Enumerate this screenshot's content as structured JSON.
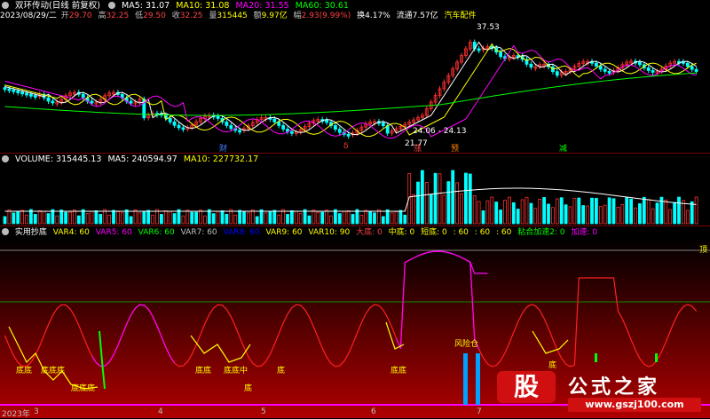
{
  "price_header": {
    "title": "双环传动(日线 前复权)",
    "ma5": "MA5: 31.07",
    "ma10": "MA10: 31.08",
    "ma20": "MA20: 31.55",
    "ma60": "MA60: 30.61",
    "colors": {
      "ma5": "#ffffff",
      "ma10": "#ffff00",
      "ma20": "#ff00ff",
      "ma60": "#00ff00"
    }
  },
  "quote_line": {
    "date": "2023/08/29/二",
    "open_label": "开",
    "open": "29.70",
    "high_label": "高",
    "high": "32.25",
    "low_label": "低",
    "low": "29.50",
    "close_label": "收",
    "close": "32.25",
    "vol_label": "量",
    "vol": "315445",
    "amount_label": "额",
    "amount": "9.97亿",
    "change_label": "幅",
    "change": "2.93(9.99%)",
    "turnover": "换4.17%",
    "float": "流通7.57亿",
    "sector": "汽车配件"
  },
  "price_annotations": {
    "high_marker": "37.53",
    "low_marker": "21.77",
    "range_marker": "24.06 - 24.13",
    "event_cai": "财",
    "event_zhang": "涨",
    "event_jia": "预",
    "event_jian": "减",
    "event_star": "δ"
  },
  "volume_header": {
    "label": "VOLUME: 315445.13",
    "ma5": "MA5: 240594.97",
    "ma10": "MA10: 227732.17"
  },
  "indicator_header": {
    "name": "实用抄底",
    "var4": "VAR4: 60",
    "var5": "VAR5: 60",
    "var6": "VAR6: 60",
    "var7": "VAR7: 60",
    "var8": "VAR8: 60",
    "var9": "VAR9: 60",
    "var10": "VAR10: 90",
    "dadi": "大底: 0",
    "zhongdi": "中底: 0",
    "duandi": "短底: 0",
    "v60a": ": 60",
    "v60b": ": 60",
    "v60c": ": 60",
    "nianhe": "粘合加速2: 0",
    "jiasu": "加速: 0"
  },
  "indicator_labels": {
    "top": "顶",
    "fengxian": "风险仓",
    "di_labels": [
      "底底",
      "底底底",
      "底底底",
      "底底",
      "底底中",
      "底",
      "底",
      "底底",
      "底"
    ]
  },
  "x_axis": {
    "year": "2023年",
    "months": [
      "3",
      "4",
      "5",
      "6",
      "7"
    ]
  },
  "watermark": {
    "logo_char": "股",
    "title": "公式之家",
    "url": "www.gszj100.com"
  },
  "chart_data": {
    "type": "candlestick",
    "title": "双环传动(日线 前复权)",
    "price_range": [
      21.77,
      37.53
    ],
    "series": [
      {
        "name": "MA5",
        "value": 31.07
      },
      {
        "name": "MA10",
        "value": 31.08
      },
      {
        "name": "MA20",
        "value": 31.55
      },
      {
        "name": "MA60",
        "value": 30.61
      }
    ],
    "annotations": [
      {
        "text": "37.53",
        "meaning": "high"
      },
      {
        "text": "21.77",
        "meaning": "low"
      }
    ]
  }
}
